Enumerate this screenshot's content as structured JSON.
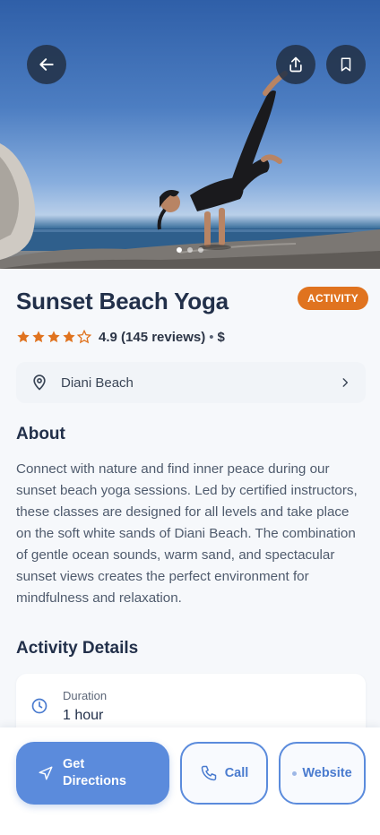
{
  "hero": {
    "image_alt": "Woman doing yoga pose on beach rocks at sunset",
    "carousel": {
      "total": 3,
      "active": 1
    },
    "icons": {
      "back": "arrow-left-icon",
      "share": "share-icon",
      "save": "bookmark-icon"
    }
  },
  "place": {
    "title": "Sunset Beach Yoga",
    "badge": "ACTIVITY",
    "rating_stars": 4.5,
    "rating_text": "4.9 (145 reviews)",
    "separator": "•",
    "price": "$"
  },
  "location": {
    "label": "Diani Beach",
    "icon": "map-pin-icon",
    "chevron": "chevron-right-icon"
  },
  "about": {
    "title": "About",
    "text": "Connect with nature and find inner peace during our sunset beach yoga sessions. Led by certified instructors, these classes are designed for all levels and take place on the soft white sands of Diani Beach. The combination of gentle ocean sounds, warm sand, and spectacular sunset views creates the perfect environment for mindfulness and relaxation."
  },
  "details": {
    "title": "Activity Details",
    "items": [
      {
        "label": "Duration",
        "value": "1 hour",
        "icon": "clock-icon"
      }
    ]
  },
  "actions": {
    "directions": "Get Directions",
    "call": "Call",
    "website": "Website"
  },
  "colors": {
    "accent": "#5b8bdc",
    "badge": "#e0731f",
    "star": "#e0731f",
    "title": "#22304a"
  }
}
